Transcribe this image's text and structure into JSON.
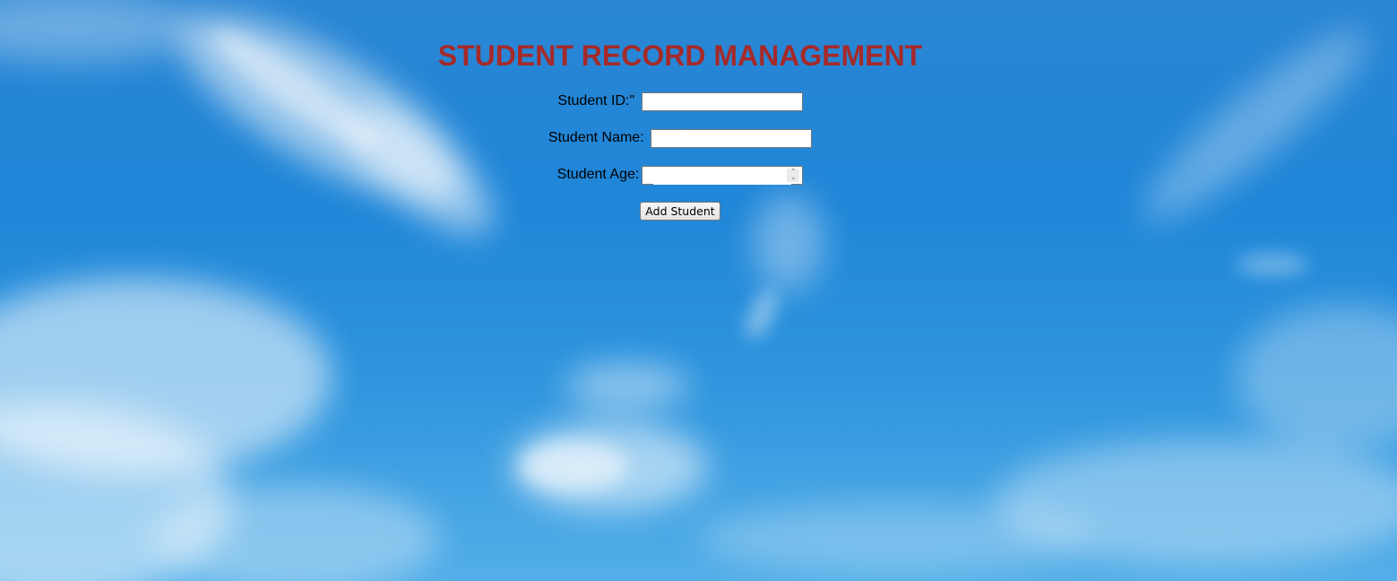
{
  "page": {
    "title": "STUDENT RECORD MANAGEMENT"
  },
  "form": {
    "student_id_label": "Student ID:\"",
    "student_id_value": "",
    "student_name_label": "Student Name:",
    "student_name_value": "",
    "student_age_label": "Student Age:",
    "student_age_value": "",
    "add_button_label": "Add Student"
  },
  "colors": {
    "title": "#a52a2a",
    "sky": "#1f86d8"
  },
  "icons": {
    "age_spinner": "spinner-up-down-icon"
  }
}
